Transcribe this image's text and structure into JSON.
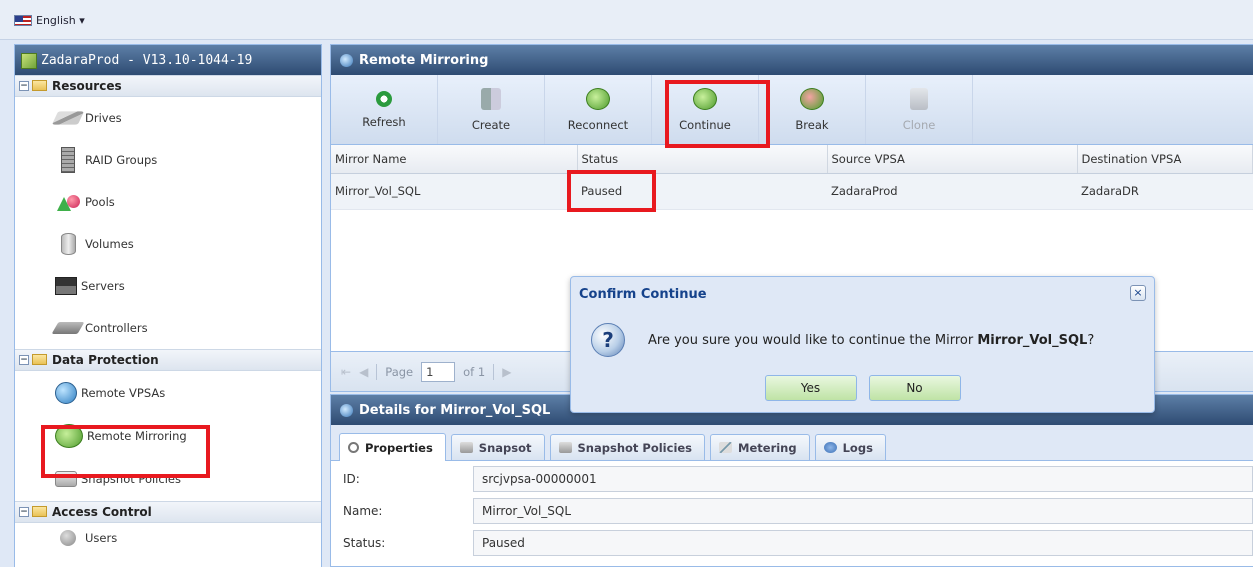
{
  "lang": {
    "label": "English ▾"
  },
  "sidebar": {
    "title": "ZadaraProd - V13.10-1044-19",
    "sections": [
      {
        "label": "Resources",
        "toggle": "−"
      },
      {
        "label": "Data Protection",
        "toggle": "−"
      },
      {
        "label": "Access Control",
        "toggle": "−"
      }
    ],
    "items": {
      "drives": "Drives",
      "raid": "RAID Groups",
      "pools": "Pools",
      "volumes": "Volumes",
      "servers": "Servers",
      "controllers": "Controllers",
      "remote_vpsas": "Remote VPSAs",
      "remote_mirroring": "Remote Mirroring",
      "snapshot_policies": "Snapshot Policies",
      "users": "Users"
    }
  },
  "main": {
    "title": "Remote Mirroring",
    "toolbar": {
      "refresh": "Refresh",
      "create": "Create",
      "reconnect": "Reconnect",
      "continue": "Continue",
      "break": "Break",
      "clone": "Clone"
    },
    "columns": [
      "Mirror Name",
      "Status",
      "Source VPSA",
      "Destination VPSA"
    ],
    "rows": [
      {
        "name": "Mirror_Vol_SQL",
        "status": "Paused",
        "source": "ZadaraProd",
        "dest": "ZadaraDR"
      }
    ],
    "pager": {
      "first": "⇤",
      "prev": "◀",
      "page_label": "Page",
      "page_value": "1",
      "of": "of 1",
      "next": "▶"
    }
  },
  "details": {
    "title": "Details for Mirror_Vol_SQL",
    "tabs": [
      "Properties",
      "Snapsot",
      "Snapshot Policies",
      "Metering",
      "Logs"
    ],
    "fields": [
      {
        "label": "ID:",
        "value": "srcjvpsa-00000001"
      },
      {
        "label": "Name:",
        "value": "Mirror_Vol_SQL"
      },
      {
        "label": "Status:",
        "value": "Paused"
      }
    ]
  },
  "modal": {
    "title": "Confirm Continue",
    "close": "×",
    "icon": "?",
    "message_prefix": "Are you sure you would like to continue the Mirror ",
    "message_bold": "Mirror_Vol_SQL",
    "message_suffix": "?",
    "yes": "Yes",
    "no": "No"
  },
  "colors": {
    "highlight": "#e8191f",
    "header": "#2e4b72",
    "panel_bg": "#dfe8f6"
  },
  "icons": {
    "flag": "us-flag-icon",
    "drives": "drive-icon",
    "raid": "raid-group-icon",
    "pools": "pools-icon",
    "volumes": "volume-icon",
    "servers": "server-icon",
    "controllers": "controller-icon",
    "remote_vpsas": "globe-icon",
    "remote_mirroring": "mirror-icon",
    "snapshot_policies": "camera-icon",
    "users": "user-icon",
    "question": "question-icon"
  }
}
